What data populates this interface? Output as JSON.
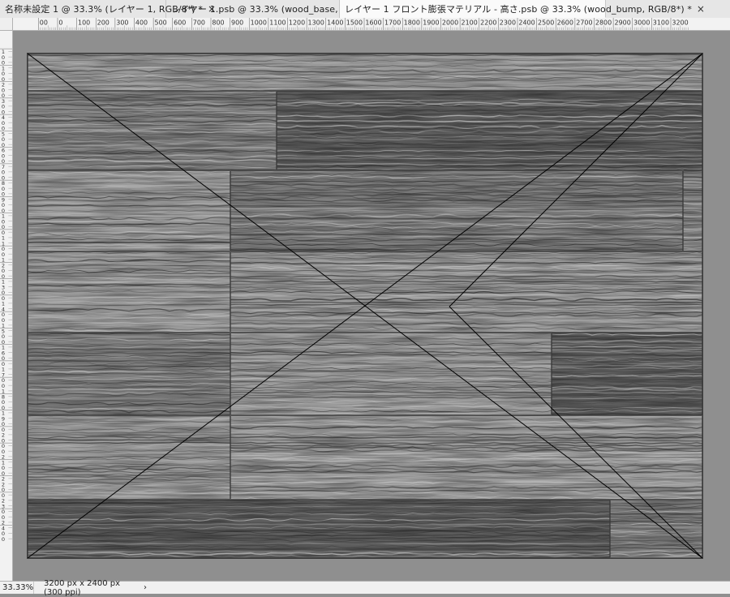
{
  "tabs": [
    {
      "label": "名称未設定 1 @ 33.3% (レイヤー 1, RGB/8*) *",
      "close": "×"
    },
    {
      "label": "レイヤー 1.psb @ 33.3% (wood_base, RGB/8*) *",
      "close": "×"
    },
    {
      "label": "レイヤー 1 フロント膨張マテリアル - 高さ.psb @ 33.3% (wood_bump, RGB/8*) *",
      "close": "×"
    }
  ],
  "ruler": {
    "horizontal_labels": [
      "00",
      "0",
      "100",
      "200",
      "300",
      "400",
      "500",
      "600",
      "700",
      "800",
      "900",
      "1000",
      "1100",
      "1200",
      "1300",
      "1400",
      "1500",
      "1600",
      "1700",
      "1800",
      "1900",
      "2000",
      "2100",
      "2200",
      "2300",
      "2400",
      "2500",
      "2600",
      "2700",
      "2800",
      "2900",
      "3000",
      "3100",
      "3200"
    ],
    "vertical_labels": [
      "1",
      "0",
      "0",
      "1",
      "0",
      "0",
      "2",
      "0",
      "0",
      "3",
      "0",
      "0",
      "4",
      "0",
      "0",
      "5",
      "0",
      "0",
      "6",
      "0",
      "0",
      "7",
      "0",
      "0",
      "8",
      "0",
      "0",
      "9",
      "0",
      "0",
      "1",
      "0",
      "0",
      "0",
      "1",
      "1",
      "0",
      "0",
      "1",
      "2",
      "0",
      "0",
      "1",
      "3",
      "0",
      "0",
      "1",
      "4",
      "0",
      "0",
      "1",
      "5",
      "0",
      "0",
      "1",
      "6",
      "0",
      "0",
      "1",
      "7",
      "0",
      "0",
      "1",
      "8",
      "0",
      "0",
      "1",
      "9",
      "0",
      "0",
      "2",
      "0",
      "0",
      "0",
      "2",
      "1",
      "0",
      "0",
      "2",
      "2",
      "0",
      "0",
      "2",
      "3",
      "0",
      "0",
      "2",
      "4",
      "0",
      "0"
    ]
  },
  "status": {
    "zoom": "33.33%",
    "doc_info": "3200 px x 2400 px (300 ppi)",
    "arrow": "›"
  },
  "colors": {
    "wood_light": "#9b9b9b",
    "wood_mid": "#7f7f7f",
    "wood_dark": "#5e5e5e",
    "grain_dark": "#3b3b3b",
    "grain_light": "#c3c3c3"
  }
}
